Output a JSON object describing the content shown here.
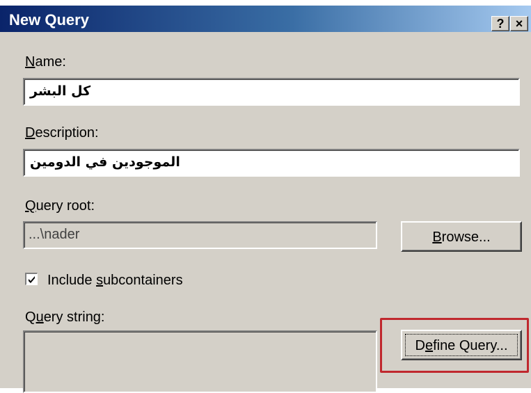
{
  "dialog": {
    "title": "New Query",
    "help_label": "?",
    "close_label": "×"
  },
  "name": {
    "label_mnemonic": "N",
    "label_rest": "ame:",
    "value": "كل البشر"
  },
  "description": {
    "label_mnemonic": "D",
    "label_rest": "escription:",
    "value": "الموجودين في الدومين"
  },
  "query_root": {
    "label_mnemonic": "Q",
    "label_rest": "uery root:",
    "value": "...\\nader",
    "browse_mnemonic": "B",
    "browse_rest": "rowse..."
  },
  "include_subcontainers": {
    "label_before": "Include ",
    "label_mnemonic": "s",
    "label_after": "ubcontainers",
    "checked": true
  },
  "query_string": {
    "label_first": "Q",
    "label_mnemonic": "u",
    "label_rest": "ery string:",
    "value": "",
    "define_before": "D",
    "define_mnemonic": "e",
    "define_after": "fine Query..."
  },
  "colors": {
    "titlebar_start": "#0a246a",
    "titlebar_end": "#a6caf0",
    "highlight": "#c0282e",
    "dialog_bg": "#d4d0c8"
  }
}
